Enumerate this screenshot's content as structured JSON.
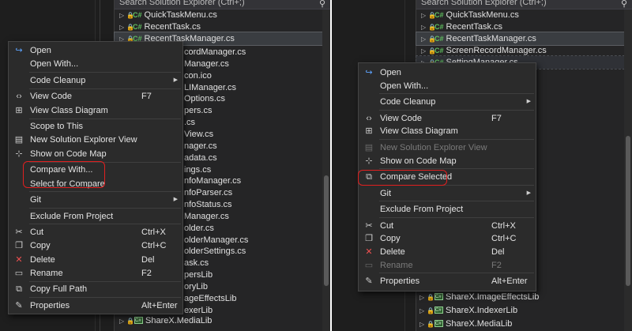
{
  "search": {
    "text": "Search Solution Explorer (Ctrl+;)"
  },
  "left": {
    "tree_top": [
      "QuickTaskMenu.cs",
      "RecentTask.cs",
      "RecentTaskManager.cs"
    ],
    "tree_partial": [
      "cordManager.cs",
      "Manager.cs",
      "con.ico",
      "LIManager.cs",
      "Options.cs",
      "pers.cs",
      ".cs",
      "View.cs",
      "nager.cs",
      "adata.cs",
      "ings.cs",
      "nfoManager.cs",
      "nfoParser.cs",
      "nfoStatus.cs",
      "Manager.cs",
      "older.cs",
      "olderManager.cs",
      "olderSettings.cs",
      "ask.cs",
      "persLib",
      "oryLib",
      "ageEffectsLib",
      "exerLib"
    ],
    "tree_bottom": "ShareX.MediaLib",
    "menu": [
      {
        "label": "Open",
        "icon": "open-arrow-icon"
      },
      {
        "label": "Open With..."
      },
      {
        "sep": true
      },
      {
        "label": "Code Cleanup",
        "submenu": true
      },
      {
        "sep": true
      },
      {
        "label": "View Code",
        "shortcut": "F7",
        "icon": "code-brackets-icon"
      },
      {
        "label": "View Class Diagram",
        "icon": "class-diagram-icon"
      },
      {
        "sep": true
      },
      {
        "label": "Scope to This"
      },
      {
        "label": "New Solution Explorer View",
        "icon": "new-explorer-view-icon"
      },
      {
        "label": "Show on Code Map",
        "icon": "code-map-icon"
      },
      {
        "sep": true
      },
      {
        "label": "Compare With..."
      },
      {
        "label": "Select for Compare"
      },
      {
        "sep": true
      },
      {
        "label": "Git",
        "submenu": true
      },
      {
        "sep": true
      },
      {
        "label": "Exclude From Project"
      },
      {
        "sep": true
      },
      {
        "label": "Cut",
        "shortcut": "Ctrl+X",
        "icon": "scissors-icon"
      },
      {
        "label": "Copy",
        "shortcut": "Ctrl+C",
        "icon": "copy-icon"
      },
      {
        "label": "Delete",
        "shortcut": "Del",
        "icon": "delete-x-icon"
      },
      {
        "label": "Rename",
        "shortcut": "F2",
        "icon": "rename-icon"
      },
      {
        "sep": true
      },
      {
        "label": "Copy Full Path",
        "icon": "copy-path-icon"
      },
      {
        "sep": true
      },
      {
        "label": "Properties",
        "shortcut": "Alt+Enter",
        "icon": "wrench-icon"
      }
    ]
  },
  "right": {
    "tree_top": [
      "QuickTaskMenu.cs",
      "RecentTask.cs",
      "RecentTaskManager.cs",
      "ScreenRecordManager.cs",
      "SettingManager.cs"
    ],
    "tree_bottom": [
      "ShareX.ImageEffectsLib",
      "ShareX.IndexerLib",
      "ShareX.MediaLib"
    ],
    "menu": [
      {
        "label": "Open",
        "icon": "open-arrow-icon"
      },
      {
        "label": "Open With..."
      },
      {
        "sep": true
      },
      {
        "label": "Code Cleanup",
        "submenu": true
      },
      {
        "sep": true
      },
      {
        "label": "View Code",
        "shortcut": "F7",
        "icon": "code-brackets-icon"
      },
      {
        "label": "View Class Diagram",
        "icon": "class-diagram-icon"
      },
      {
        "sep": true
      },
      {
        "label": "New Solution Explorer View",
        "icon": "new-explorer-view-icon",
        "disabled": true
      },
      {
        "label": "Show on Code Map",
        "icon": "code-map-icon"
      },
      {
        "sep": true
      },
      {
        "label": "Compare Selected",
        "icon": "compare-files-icon"
      },
      {
        "sep": true
      },
      {
        "label": "Git",
        "submenu": true
      },
      {
        "sep": true
      },
      {
        "label": "Exclude From Project"
      },
      {
        "sep": true
      },
      {
        "label": "Cut",
        "shortcut": "Ctrl+X",
        "icon": "scissors-icon"
      },
      {
        "label": "Copy",
        "shortcut": "Ctrl+C",
        "icon": "copy-icon"
      },
      {
        "label": "Delete",
        "shortcut": "Del",
        "icon": "delete-x-icon"
      },
      {
        "label": "Rename",
        "shortcut": "F2",
        "icon": "rename-icon",
        "disabled": true
      },
      {
        "sep": true
      },
      {
        "label": "Properties",
        "shortcut": "Alt+Enter",
        "icon": "wrench-icon"
      }
    ]
  },
  "colors": {
    "highlight": "#e02020",
    "accent": "#5ea4ff"
  }
}
